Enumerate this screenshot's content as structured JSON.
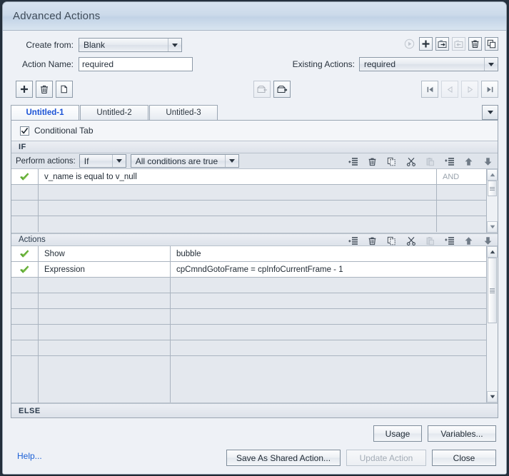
{
  "window": {
    "title": "Advanced Actions"
  },
  "form": {
    "create_from_label": "Create from:",
    "create_from_value": "Blank",
    "action_name_label": "Action Name:",
    "action_name_value": "required",
    "existing_actions_label": "Existing Actions:",
    "existing_actions_value": "required"
  },
  "top_toolbar": [
    {
      "name": "preview-action-button",
      "icon": "play-icon",
      "disabled": true
    },
    {
      "name": "add-action-button",
      "icon": "plus-icon",
      "disabled": false
    },
    {
      "name": "export-action-button",
      "icon": "export-arrow-icon",
      "disabled": false
    },
    {
      "name": "import-action-button",
      "icon": "import-arrow-icon",
      "disabled": true
    },
    {
      "name": "delete-action-button",
      "icon": "trash-icon",
      "disabled": false
    },
    {
      "name": "duplicate-action-button",
      "icon": "duplicate-icon",
      "disabled": false
    }
  ],
  "mid_toolbar": {
    "left": [
      {
        "name": "add-decision-button",
        "icon": "plus-icon"
      },
      {
        "name": "delete-decision-button",
        "icon": "trash-icon"
      },
      {
        "name": "duplicate-decision-button",
        "icon": "copy-icon"
      }
    ],
    "mid": [
      {
        "name": "import-decision-button",
        "icon": "tray-in-icon",
        "disabled": true
      },
      {
        "name": "export-decision-button",
        "icon": "tray-out-icon",
        "disabled": false
      }
    ],
    "nav": [
      {
        "name": "first-decision-button",
        "icon": "first-icon",
        "disabled": false
      },
      {
        "name": "previous-decision-button",
        "icon": "previous-icon",
        "disabled": true
      },
      {
        "name": "next-decision-button",
        "icon": "next-icon",
        "disabled": true
      },
      {
        "name": "last-decision-button",
        "icon": "last-icon",
        "disabled": false
      }
    ]
  },
  "tabs": [
    {
      "label": "Untitled-1",
      "active": true
    },
    {
      "label": "Untitled-2",
      "active": false
    },
    {
      "label": "Untitled-3",
      "active": false
    }
  ],
  "conditional_tab": {
    "label": "Conditional Tab",
    "checked": true
  },
  "if_section": {
    "header": "IF",
    "perform_label": "Perform actions:",
    "operator_value": "If",
    "condition_mode_value": "All conditions are true",
    "and_column_label": "AND",
    "rows": [
      {
        "enabled": true,
        "text": "v_name   is equal to   v_null",
        "and": "AND"
      },
      {
        "enabled": false,
        "text": "",
        "and": ""
      },
      {
        "enabled": false,
        "text": "",
        "and": ""
      },
      {
        "enabled": false,
        "text": "",
        "and": ""
      }
    ]
  },
  "actions_section": {
    "header": "Actions",
    "rows": [
      {
        "enabled": true,
        "action": "Show",
        "value": "bubble"
      },
      {
        "enabled": true,
        "action": "Expression",
        "value": "cpCmndGotoFrame   =   cpInfoCurrentFrame   -   1"
      },
      {
        "enabled": false,
        "action": "",
        "value": ""
      },
      {
        "enabled": false,
        "action": "",
        "value": ""
      },
      {
        "enabled": false,
        "action": "",
        "value": ""
      },
      {
        "enabled": false,
        "action": "",
        "value": ""
      },
      {
        "enabled": false,
        "action": "",
        "value": ""
      },
      {
        "enabled": false,
        "action": "",
        "value": ""
      }
    ]
  },
  "else_section": {
    "header": "ELSE"
  },
  "row_tools": [
    {
      "name": "add-row-button",
      "icon": "add-rows-icon",
      "disabled": false
    },
    {
      "name": "delete-row-button",
      "icon": "trash-icon",
      "disabled": false
    },
    {
      "name": "copy-row-button",
      "icon": "copy-icon",
      "disabled": false
    },
    {
      "name": "cut-row-button",
      "icon": "scissors-icon",
      "disabled": false
    },
    {
      "name": "paste-row-button",
      "icon": "paste-icon",
      "disabled": true
    },
    {
      "name": "insert-row-button",
      "icon": "insert-rows-icon",
      "disabled": false
    },
    {
      "name": "move-up-button",
      "icon": "arrow-up-icon",
      "disabled": false
    },
    {
      "name": "move-down-button",
      "icon": "arrow-down-icon",
      "disabled": false
    }
  ],
  "footer": {
    "help_label": "Help...",
    "usage_label": "Usage",
    "variables_label": "Variables...",
    "save_shared_label": "Save As Shared Action...",
    "update_action_label": "Update Action",
    "update_action_disabled": true,
    "close_label": "Close"
  },
  "colors": {
    "accent_blue": "#1a52d6",
    "link_blue": "#1a5fd6",
    "check_green": "#5aa832",
    "title_bar": "#ccdaea",
    "grid_empty": "#e4e8ee"
  }
}
